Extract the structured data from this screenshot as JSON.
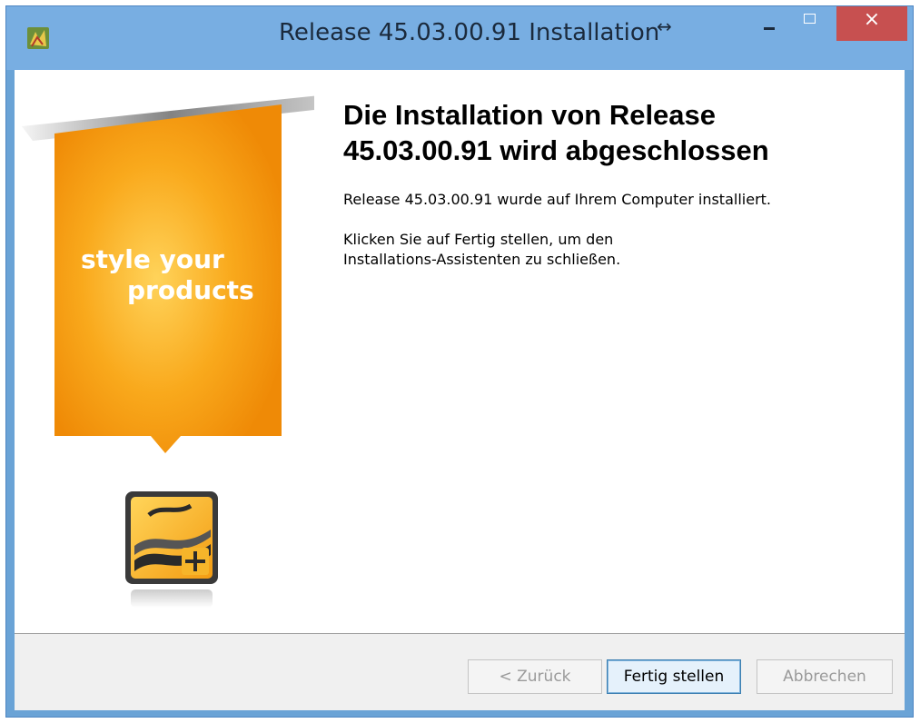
{
  "window": {
    "title": "Release 45.03.00.91 Installation",
    "title_suffix": "↔",
    "controls": {
      "minimize": "minimize",
      "maximize": "maximize",
      "close_label": "×"
    }
  },
  "sidebar": {
    "slogan_line1": "style your",
    "slogan_line2": "products",
    "accent_color": "#f39c12",
    "logo_icon": "style-your-products-logo-icon"
  },
  "main": {
    "heading": "Die Installation von Release 45.03.00.91 wird abgeschlossen",
    "paragraph1": "Release 45.03.00.91 wurde auf Ihrem Computer installiert.",
    "paragraph2_line1": "Klicken Sie auf Fertig stellen, um den",
    "paragraph2_line2": "Installations-Assistenten zu schließen."
  },
  "footer": {
    "back_label": "< Zurück",
    "finish_label": "Fertig stellen",
    "cancel_label": "Abbrechen"
  },
  "colors": {
    "titlebar": "#78aee2",
    "close": "#c75050",
    "footer": "#f0f0f0"
  }
}
